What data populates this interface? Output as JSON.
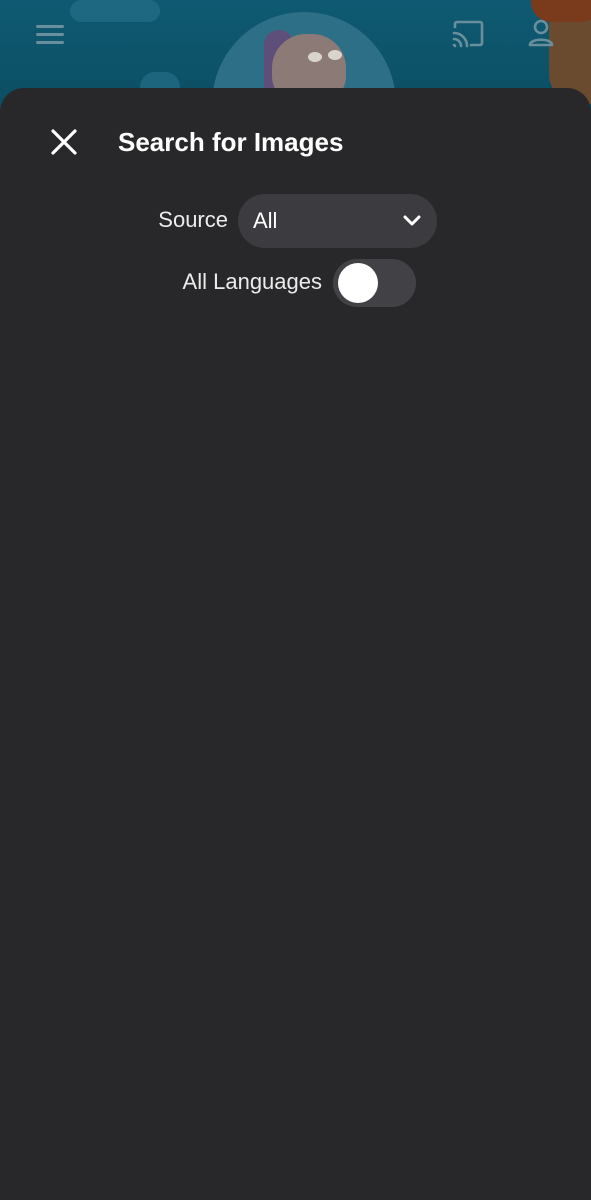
{
  "background": {
    "icons": [
      "menu-icon",
      "cast-icon",
      "account-icon"
    ],
    "accent_color": "#0f5a72"
  },
  "sheet": {
    "title": "Search for Images",
    "close_icon": "close-icon",
    "background_color": "#28282a"
  },
  "filters": {
    "source_label": "Source",
    "source_value": "All",
    "source_dropdown_icon": "chevron-down-icon",
    "languages_label": "All Languages",
    "languages_toggle_on": false
  }
}
